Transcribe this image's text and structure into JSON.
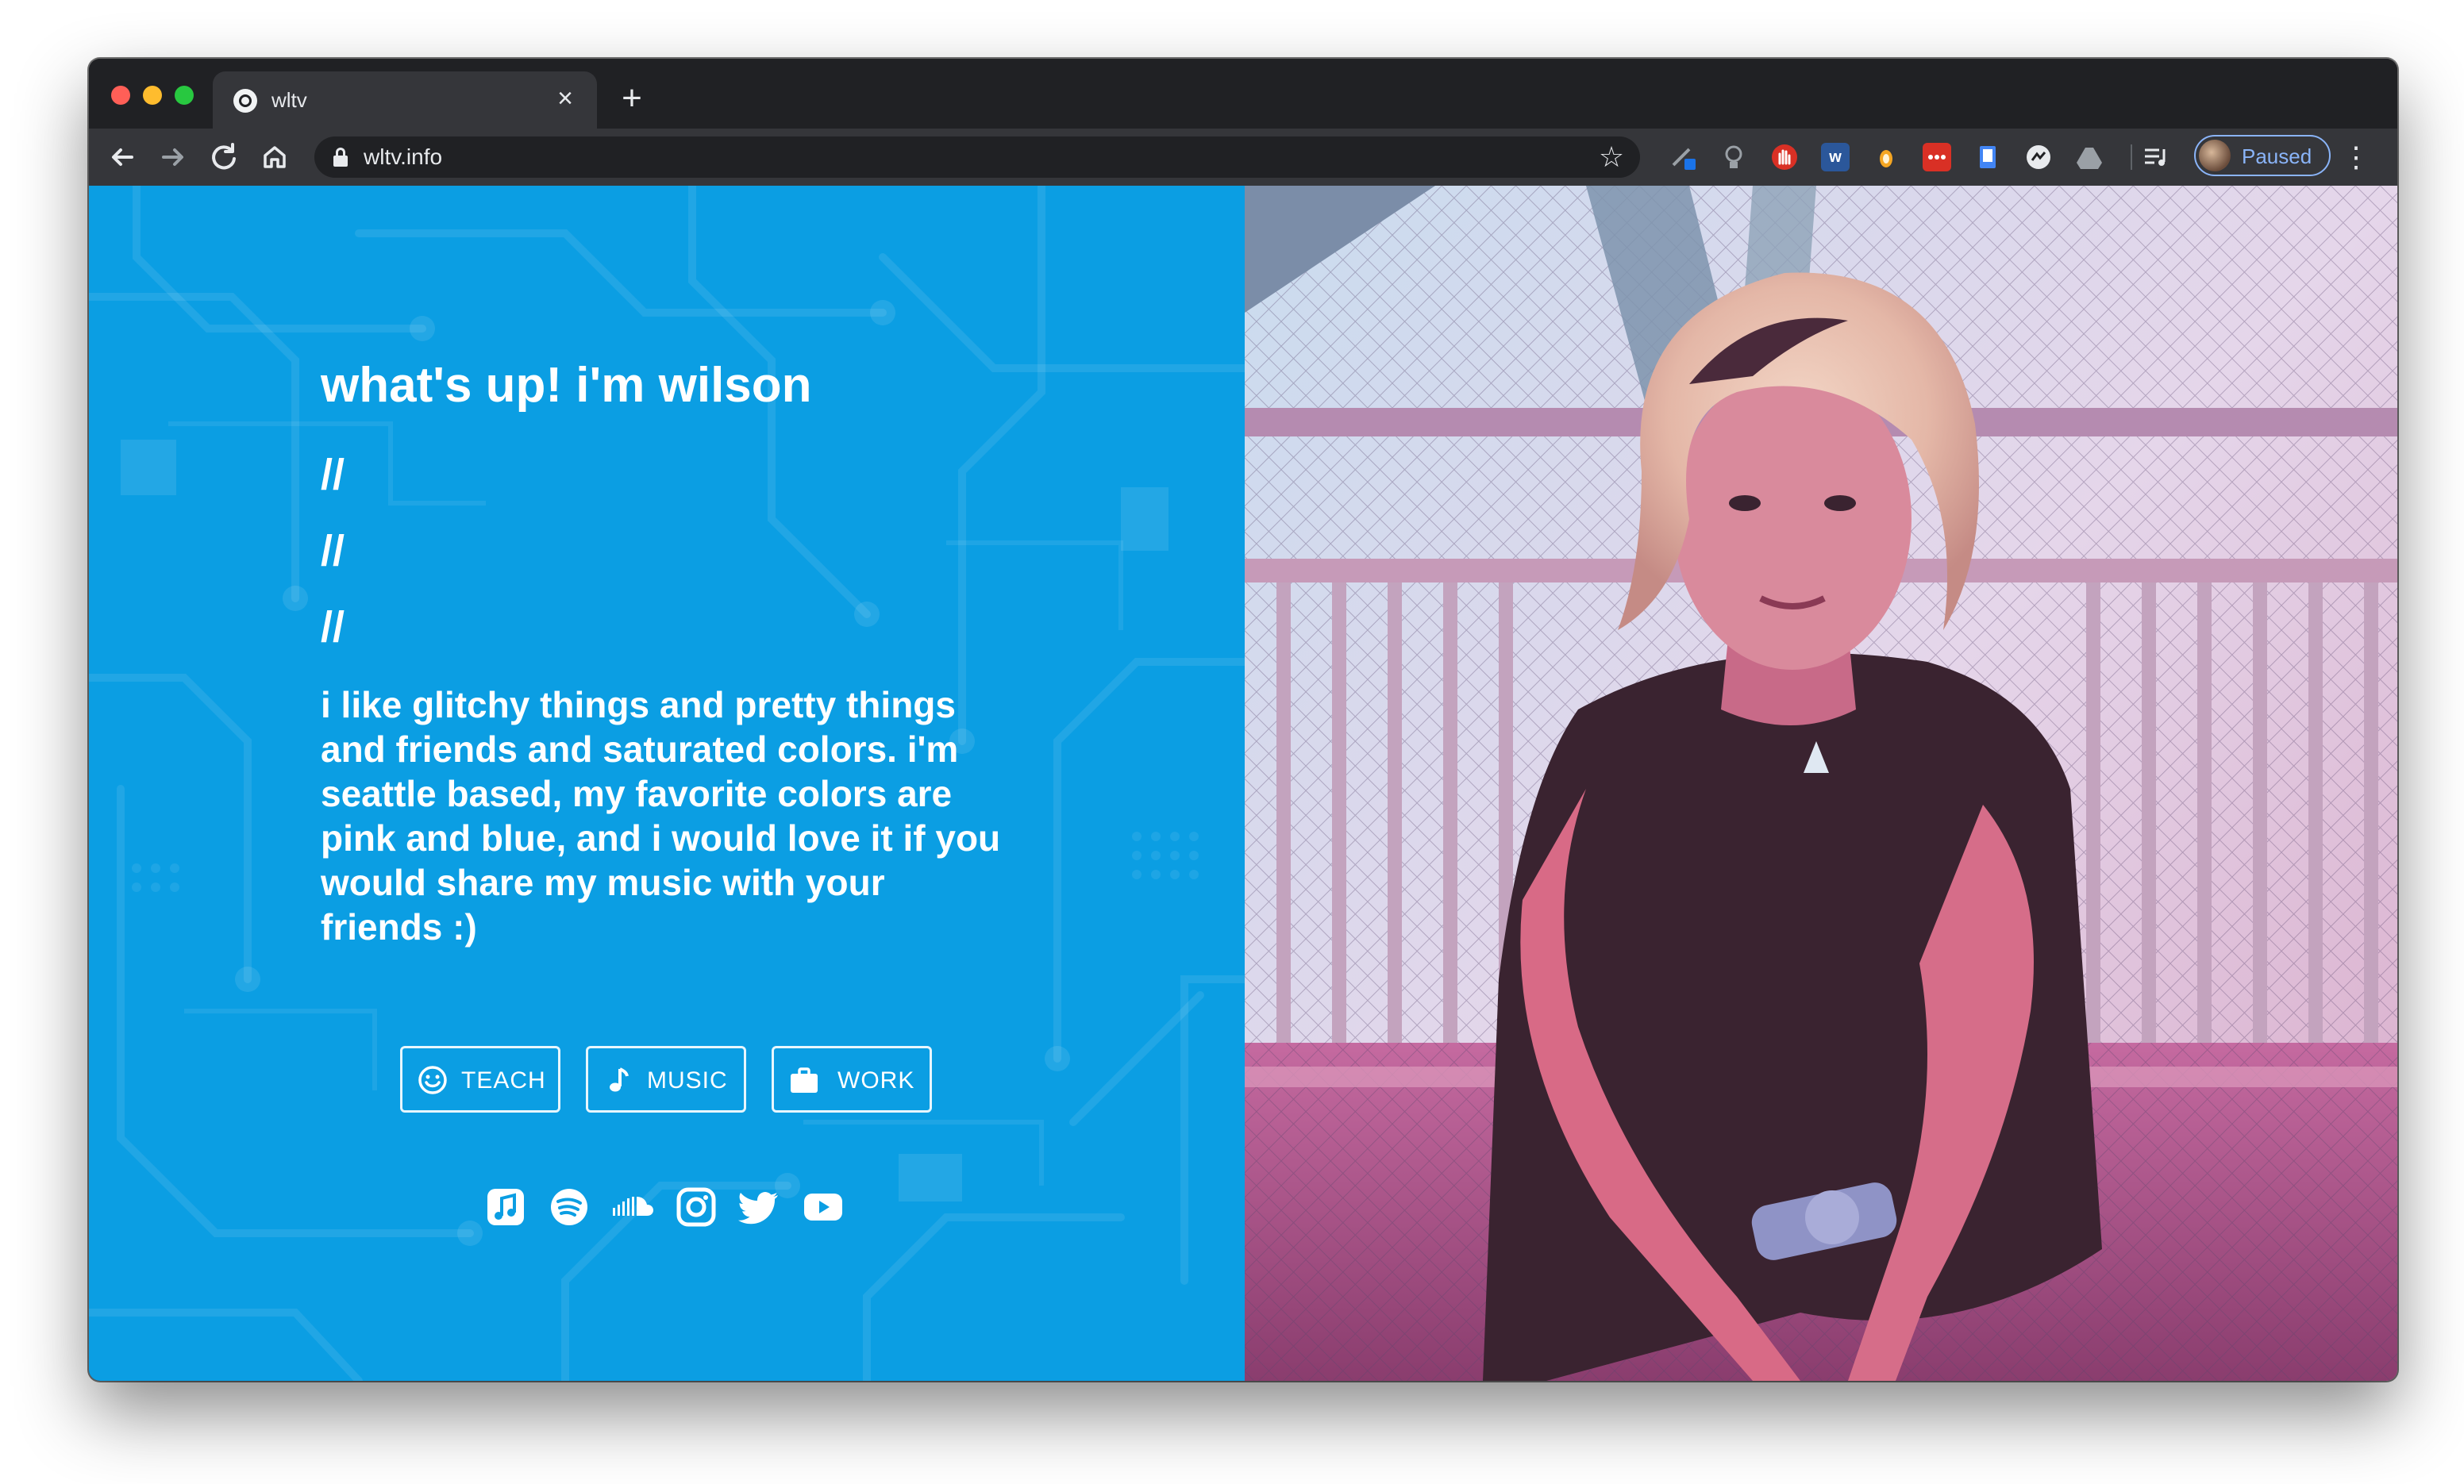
{
  "browser": {
    "tab_title": "wltv",
    "tab_close": "×",
    "new_tab": "+",
    "url": "wltv.info",
    "profile_status": "Paused",
    "extensions": [
      "w"
    ]
  },
  "page": {
    "heading": "what's up! i'm wilson",
    "dividers": [
      "//",
      "//",
      "//"
    ],
    "bio": "i like glitchy things and pretty things and friends and saturated colors. i'm seattle based, my favorite colors are pink and blue, and i would love it if you would share my music with your friends :)",
    "buttons": {
      "teach": {
        "label": "TEACH",
        "icon": "smiley-icon"
      },
      "music": {
        "label": "MUSIC",
        "icon": "music-note-icon"
      },
      "work": {
        "label": "WORK",
        "icon": "briefcase-icon"
      }
    },
    "social_links": [
      "apple-music-icon",
      "spotify-icon",
      "soundcloud-icon",
      "instagram-icon",
      "twitter-icon",
      "youtube-icon"
    ]
  },
  "colors": {
    "left_panel_bg": "#0b9ee3",
    "chrome_dark": "#202124",
    "toolbar": "#35363a"
  }
}
